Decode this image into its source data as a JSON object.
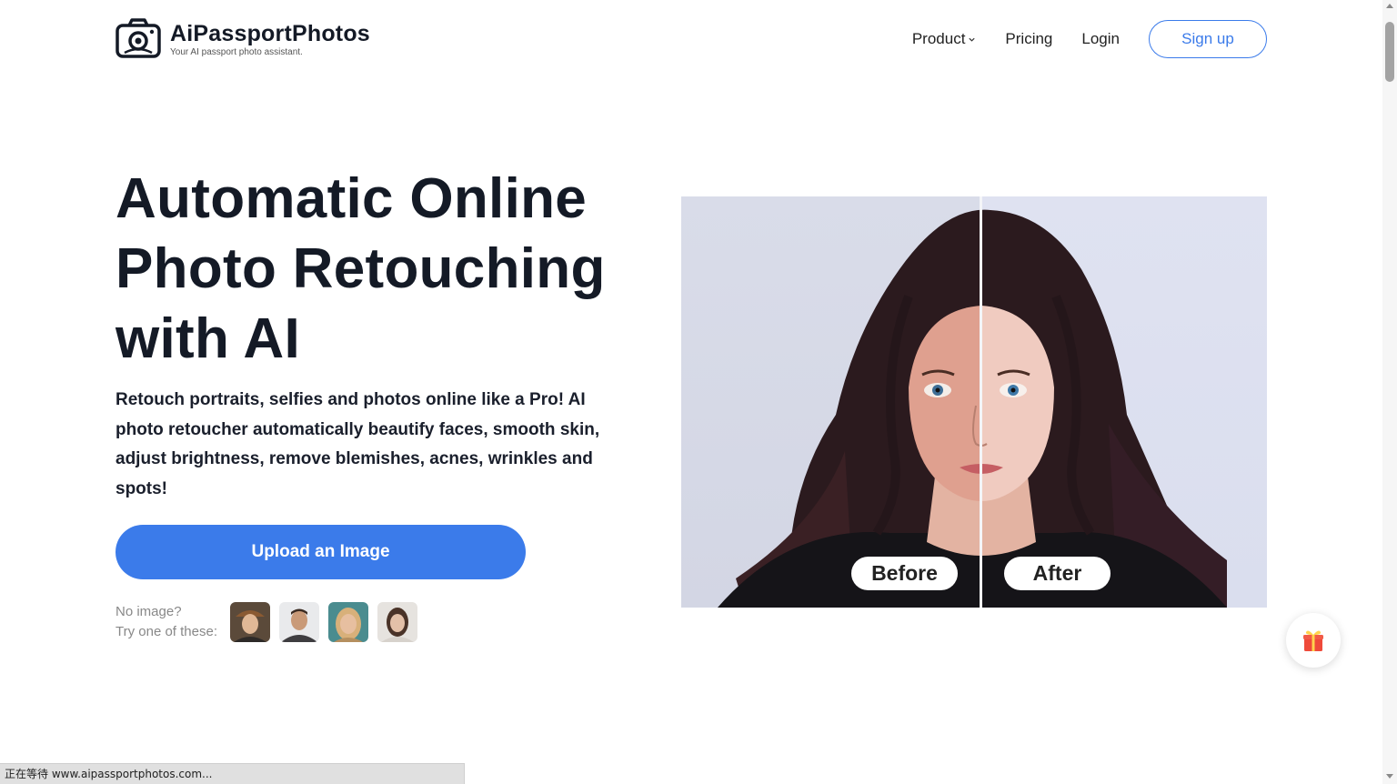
{
  "header": {
    "brand_name": "AiPassportPhotos",
    "brand_tagline": "Your AI passport photo assistant.",
    "nav": {
      "product_label": "Product",
      "pricing_label": "Pricing",
      "login_label": "Login",
      "signup_label": "Sign up"
    }
  },
  "hero": {
    "title_line1": "Automatic Online",
    "title_line2": "Photo Retouching",
    "title_line3": "with AI",
    "description": "Retouch portraits, selfies and photos online like a Pro! AI photo retoucher automatically beautify faces, smooth skin, adjust brightness, remove blemishes, acnes, wrinkles and spots!",
    "upload_button_label": "Upload an Image",
    "samples_label_line1": "No image?",
    "samples_label_line2": "Try one of these:",
    "compare_before_label": "Before",
    "compare_after_label": "After"
  },
  "statusbar": {
    "text": "正在等待 www.aipassportphotos.com..."
  },
  "colors": {
    "accent": "#3b7bea",
    "title": "#141a26",
    "text": "#1a1f2c"
  },
  "icons": {
    "logo": "camera-icon",
    "product_dropdown": "chevron-down-icon",
    "gift": "gift-icon"
  }
}
